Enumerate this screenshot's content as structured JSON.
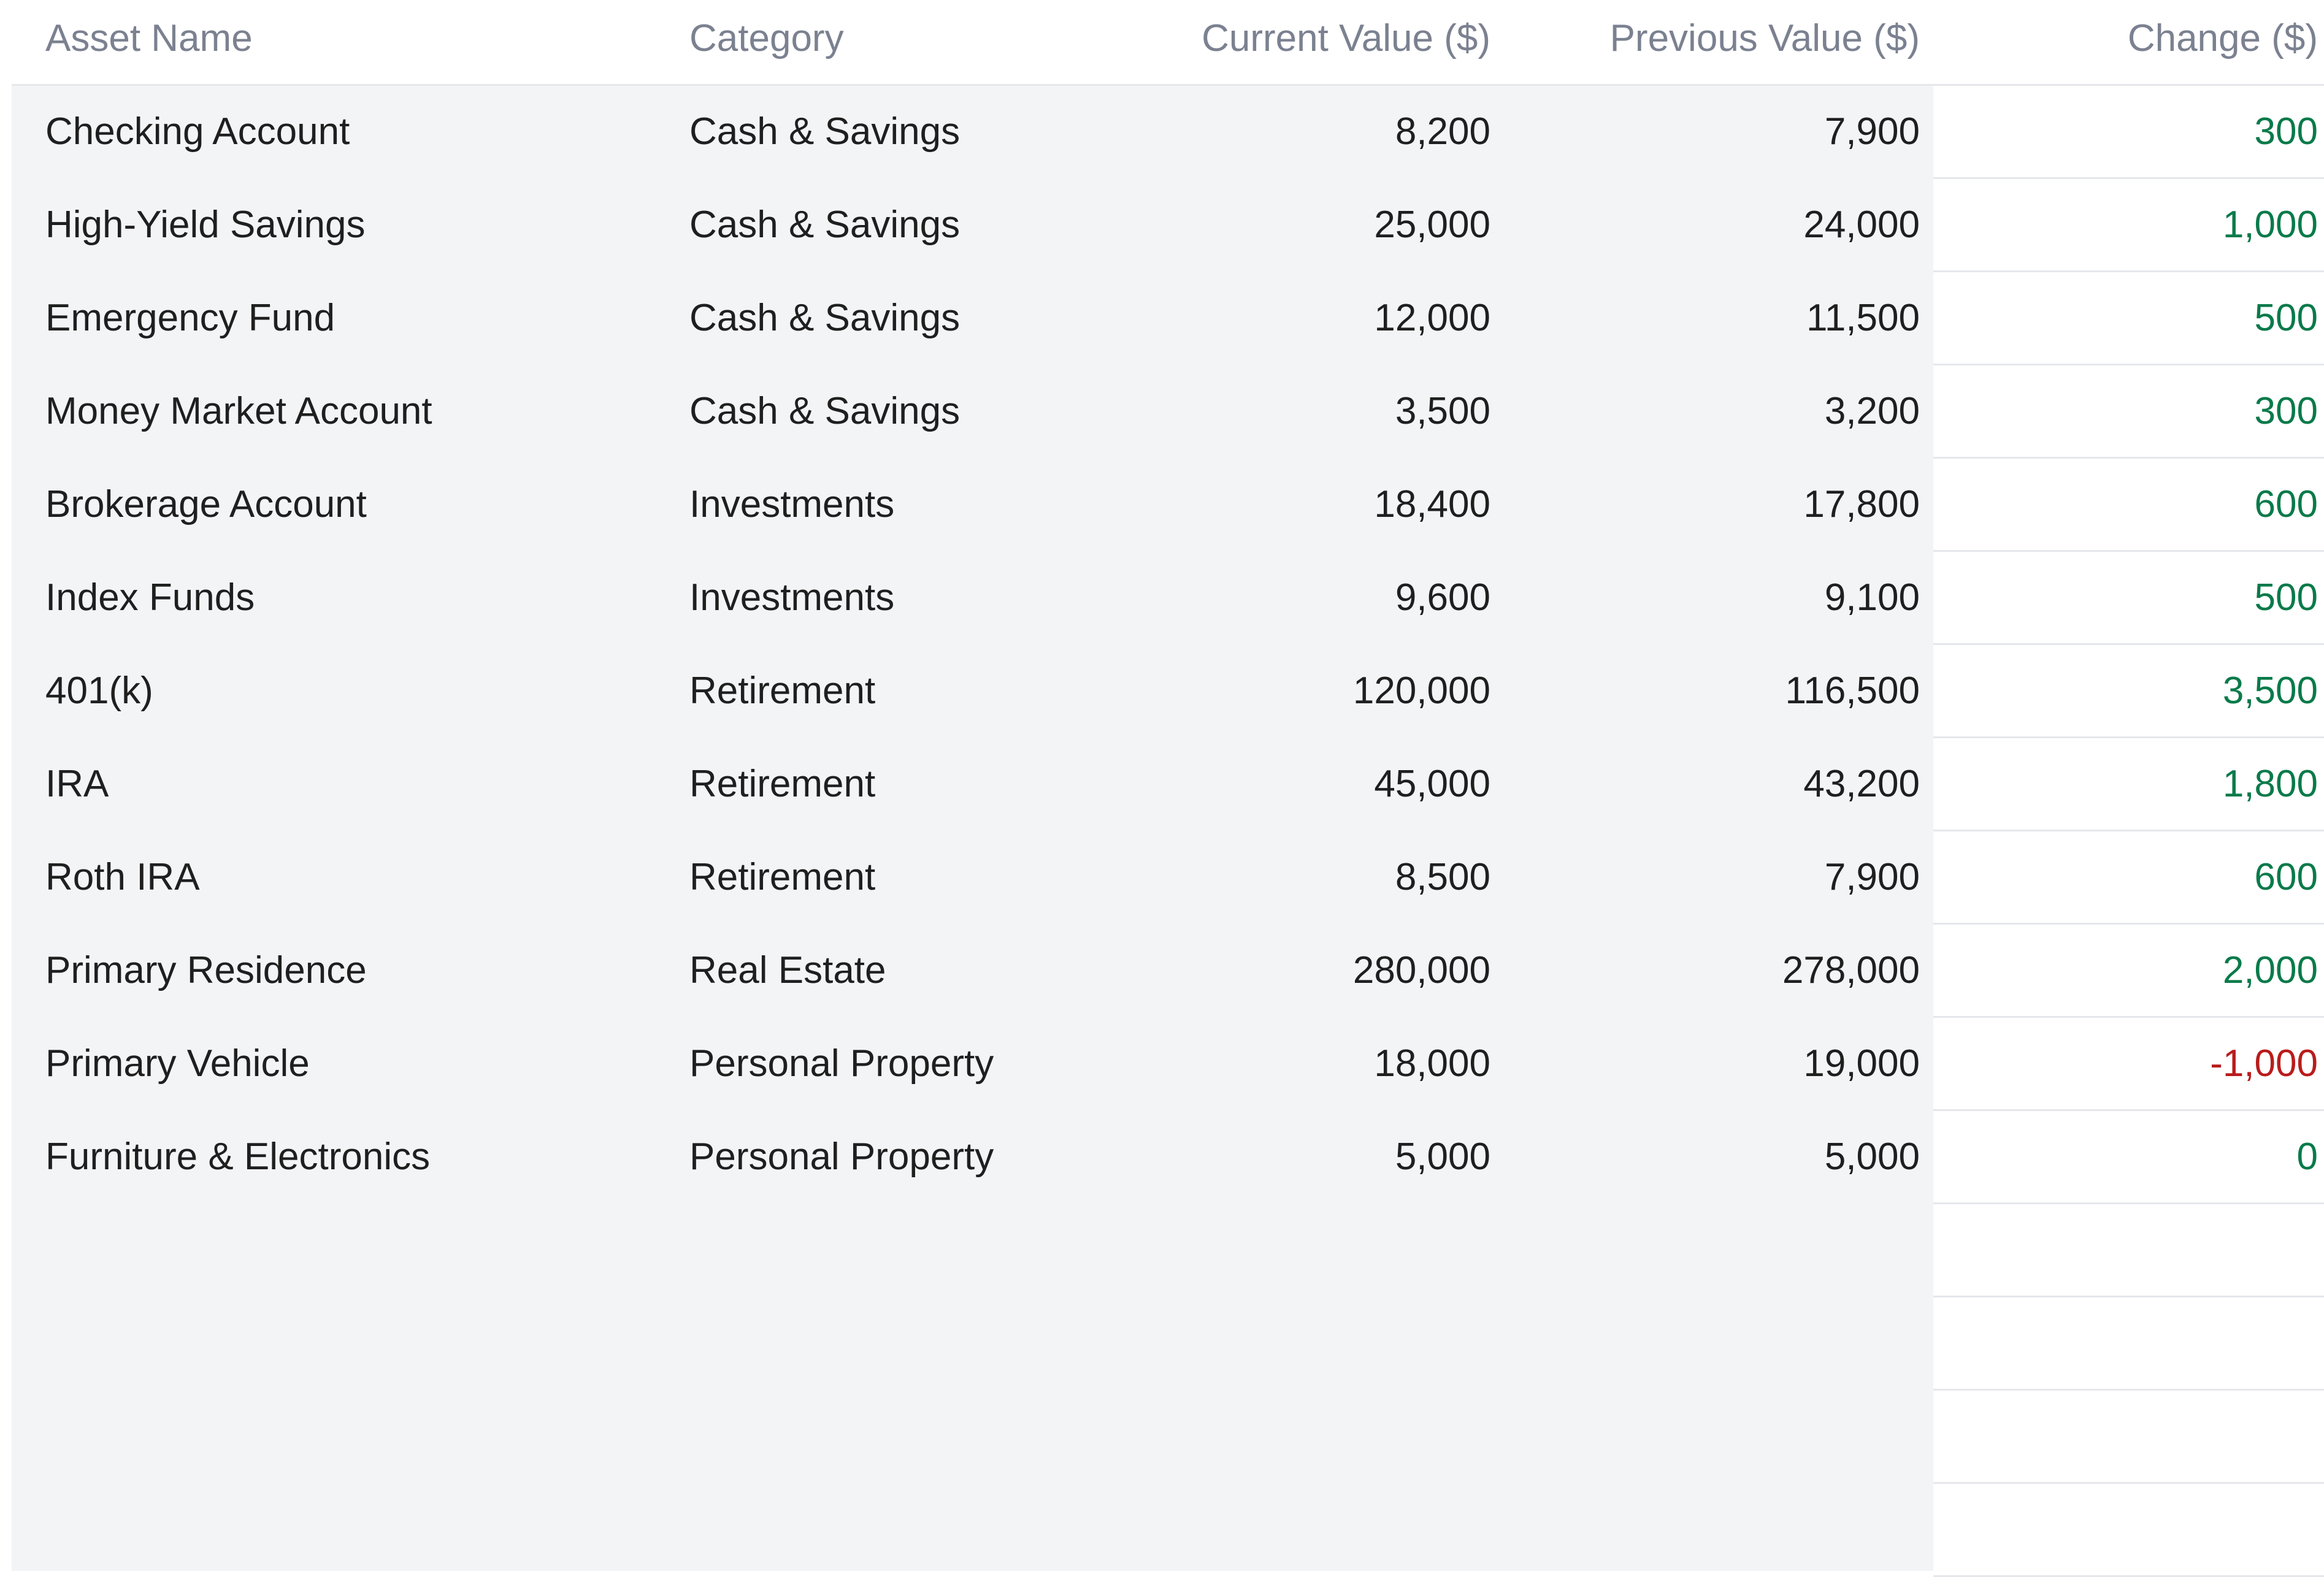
{
  "table": {
    "headers": {
      "name": "Asset Name",
      "category": "Category",
      "current": "Current Value ($)",
      "previous": "Previous Value ($)",
      "change": "Change ($)"
    },
    "rows": [
      {
        "name": "Checking Account",
        "category": "Cash & Savings",
        "current": "8,200",
        "previous": "7,900",
        "change": "300",
        "trend": "pos"
      },
      {
        "name": "High-Yield Savings",
        "category": "Cash & Savings",
        "current": "25,000",
        "previous": "24,000",
        "change": "1,000",
        "trend": "pos"
      },
      {
        "name": "Emergency Fund",
        "category": "Cash & Savings",
        "current": "12,000",
        "previous": "11,500",
        "change": "500",
        "trend": "pos"
      },
      {
        "name": "Money Market Account",
        "category": "Cash & Savings",
        "current": "3,500",
        "previous": "3,200",
        "change": "300",
        "trend": "pos"
      },
      {
        "name": "Brokerage Account",
        "category": "Investments",
        "current": "18,400",
        "previous": "17,800",
        "change": "600",
        "trend": "pos"
      },
      {
        "name": "Index Funds",
        "category": "Investments",
        "current": "9,600",
        "previous": "9,100",
        "change": "500",
        "trend": "pos"
      },
      {
        "name": "401(k)",
        "category": "Retirement",
        "current": "120,000",
        "previous": "116,500",
        "change": "3,500",
        "trend": "pos"
      },
      {
        "name": "IRA",
        "category": "Retirement",
        "current": "45,000",
        "previous": "43,200",
        "change": "1,800",
        "trend": "pos"
      },
      {
        "name": "Roth IRA",
        "category": "Retirement",
        "current": "8,500",
        "previous": "7,900",
        "change": "600",
        "trend": "pos"
      },
      {
        "name": "Primary Residence",
        "category": "Real Estate",
        "current": "280,000",
        "previous": "278,000",
        "change": "2,000",
        "trend": "pos"
      },
      {
        "name": "Primary Vehicle",
        "category": "Personal Property",
        "current": "18,000",
        "previous": "19,000",
        "change": "-1,000",
        "trend": "neg"
      },
      {
        "name": "Furniture & Electronics",
        "category": "Personal Property",
        "current": "5,000",
        "previous": "5,000",
        "change": "0",
        "trend": "zero"
      }
    ],
    "empty_rows": 4
  },
  "colors": {
    "header_text": "#7b8190",
    "body_text": "#1f1f1f",
    "panel_bg": "#f3f4f6",
    "positive": "#0a7a4a",
    "negative": "#b91c1c",
    "divider": "#e5e7eb"
  }
}
